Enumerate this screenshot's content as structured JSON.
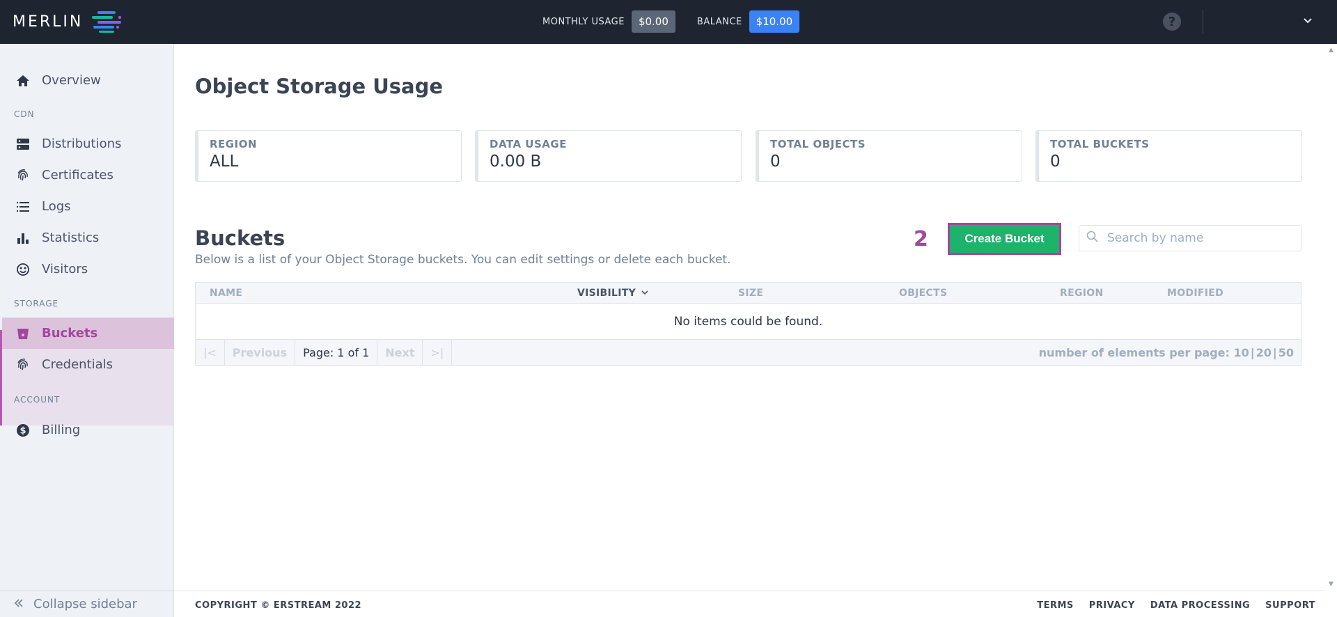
{
  "header": {
    "logo_text": "MERLIN",
    "monthly_usage_label": "MONTHLY USAGE",
    "monthly_usage_value": "$0.00",
    "balance_label": "BALANCE",
    "balance_value": "$10.00",
    "help_glyph": "?"
  },
  "sidebar": {
    "overview": "Overview",
    "cdn_section": "CDN",
    "distributions": "Distributions",
    "certificates": "Certificates",
    "logs": "Logs",
    "statistics": "Statistics",
    "visitors": "Visitors",
    "storage_section": "STORAGE",
    "buckets": "Buckets",
    "credentials": "Credentials",
    "account_section": "ACCOUNT",
    "billing": "Billing",
    "collapse": "Collapse sidebar"
  },
  "main": {
    "page_title": "Object Storage Usage",
    "stats": [
      {
        "label": "REGION",
        "value": "ALL"
      },
      {
        "label": "DATA USAGE",
        "value": "0.00 B"
      },
      {
        "label": "TOTAL OBJECTS",
        "value": "0"
      },
      {
        "label": "TOTAL BUCKETS",
        "value": "0"
      }
    ],
    "buckets_title": "Buckets",
    "buckets_desc": "Below is a list of your Object Storage buckets. You can edit settings or delete each bucket.",
    "step_number": "2",
    "create_button": "Create Bucket",
    "search_placeholder": "Search by name"
  },
  "table": {
    "columns": [
      "NAME",
      "VISIBILITY",
      "SIZE",
      "OBJECTS",
      "REGION",
      "MODIFIED"
    ],
    "sorted_column": "VISIBILITY",
    "empty_message": "No items could be found.",
    "pager": {
      "first": "|<",
      "previous": "Previous",
      "page_info": "Page: 1 of 1",
      "next": "Next",
      "last": ">|",
      "per_page_label": "number of elements per page:",
      "per_page_options": [
        "10",
        "20",
        "50"
      ]
    }
  },
  "footer": {
    "copyright": "COPYRIGHT © ERSTREAM 2022",
    "links": [
      "TERMS",
      "PRIVACY",
      "DATA PROCESSING",
      "SUPPORT"
    ]
  },
  "colors": {
    "topbar": "#1e2531",
    "accent_purple": "#a1479e",
    "create_green": "#1db36a",
    "balance_blue": "#3b82f6"
  },
  "icons": {
    "overview": "home-icon",
    "distributions": "server-icon",
    "certificates": "fingerprint-icon",
    "logs": "list-icon",
    "statistics": "bar-chart-icon",
    "visitors": "smiley-icon",
    "buckets": "bucket-icon",
    "credentials": "fingerprint-icon",
    "billing": "dollar-icon"
  }
}
